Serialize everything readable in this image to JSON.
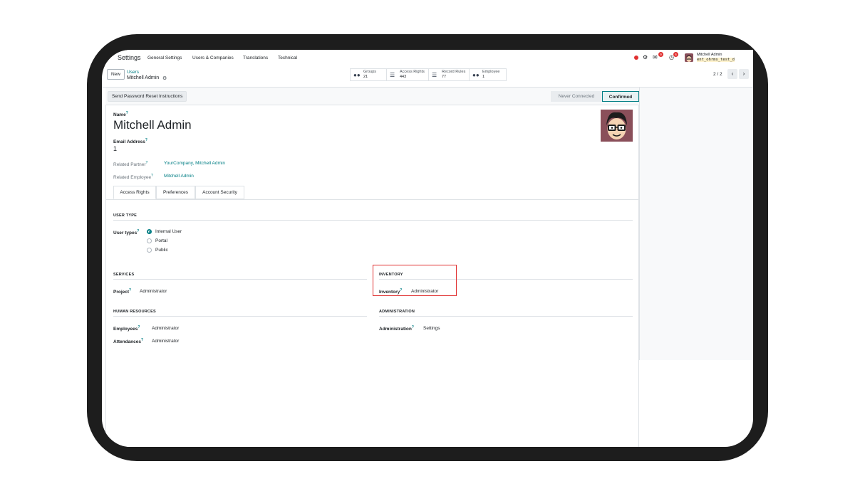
{
  "navbar": {
    "app_name": "Settings",
    "menu": [
      "General Settings",
      "Users & Companies",
      "Translations",
      "Technical"
    ],
    "chat_badge": "9",
    "activity_badge": "6",
    "user_name": "Mitchell Admin",
    "database": "ent_ohrms_test_d"
  },
  "control_panel": {
    "new_label": "New",
    "breadcrumb_parent": "Users",
    "breadcrumb_current": "Mitchell Admin",
    "smart_buttons": [
      {
        "label": "Groups",
        "value": "21",
        "icon": "users-icon"
      },
      {
        "label": "Access Rights",
        "value": "443",
        "icon": "list-icon"
      },
      {
        "label": "Record Rules",
        "value": "77",
        "icon": "list-icon"
      },
      {
        "label": "Employee",
        "value": "1",
        "icon": "users-icon"
      }
    ],
    "pager": "2 / 2"
  },
  "statusbar": {
    "reset_button": "Send Password Reset Instructions",
    "steps": [
      "Never Connected",
      "Confirmed"
    ],
    "active_step": "Confirmed"
  },
  "form": {
    "name_label": "Name",
    "name_value": "Mitchell Admin",
    "email_label": "Email Address",
    "email_value": "1",
    "related_partner_label": "Related Partner",
    "related_partner_value": "YourCompany, Mitchell Admin",
    "related_employee_label": "Related Employee",
    "related_employee_value": "Mitchell Admin",
    "help_mark": "?"
  },
  "tabs": [
    "Access Rights",
    "Preferences",
    "Account Security"
  ],
  "access_rights": {
    "user_type_title": "USER TYPE",
    "user_types_label": "User types",
    "user_types": [
      "Internal User",
      "Portal",
      "Public"
    ],
    "selected_user_type": "Internal User",
    "services_title": "SERVICES",
    "project_label": "Project",
    "project_value": "Administrator",
    "inventory_title": "INVENTORY",
    "inventory_label": "Inventory",
    "inventory_value": "Administrator",
    "hr_title": "HUMAN RESOURCES",
    "employees_label": "Employees",
    "employees_value": "Administrator",
    "attendances_label": "Attendances",
    "attendances_value": "Administrator",
    "admin_title": "ADMINISTRATION",
    "administration_label": "Administration",
    "administration_value": "Settings"
  },
  "colors": {
    "accent": "#017e84",
    "highlight": "#e03131",
    "badge": "#e03131"
  }
}
